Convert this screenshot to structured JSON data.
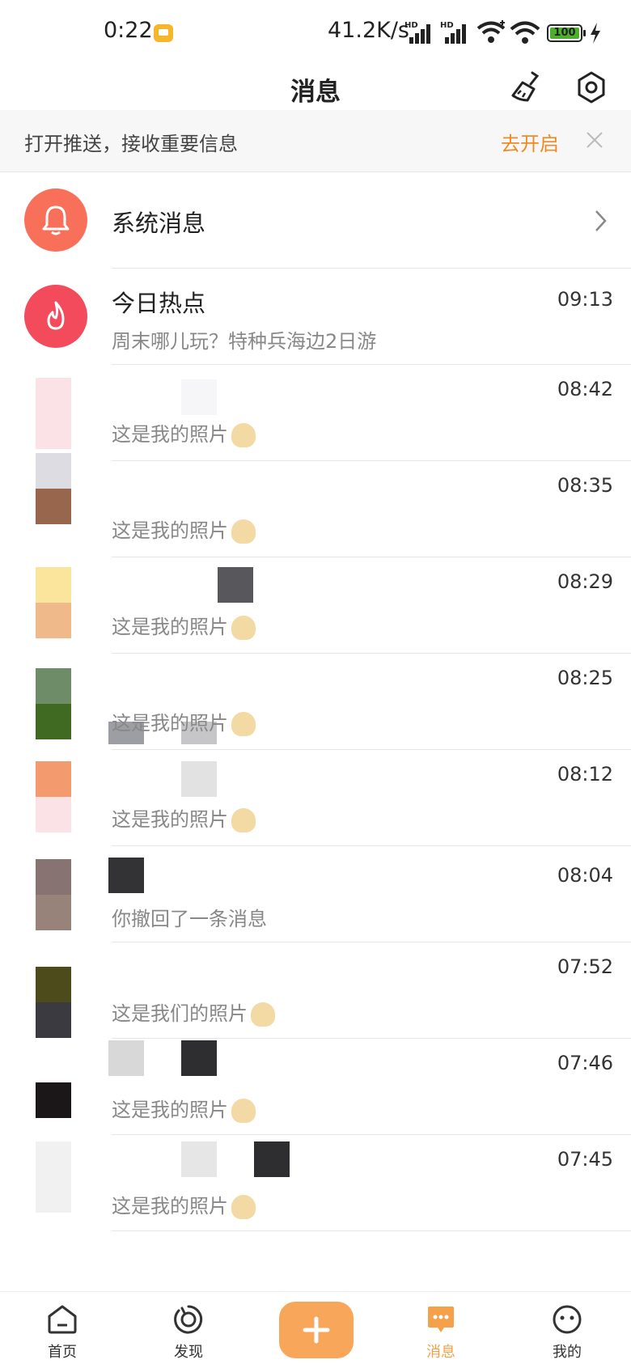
{
  "status_bar": {
    "time": "0:22",
    "net_speed": "41.2K/s",
    "battery": "100"
  },
  "header": {
    "title": "消息",
    "clean_icon": "broom-icon",
    "settings_icon": "hex-settings-icon"
  },
  "push_banner": {
    "text": "打开推送，接收重要信息",
    "action": "去开启"
  },
  "system_row": {
    "title": "系统消息",
    "icon": "bell-icon",
    "icon_bg": "#f8705a"
  },
  "hot_row": {
    "title": "今日热点",
    "subtitle": "周末哪儿玩？特种兵海边2日游",
    "time": "09:13",
    "icon": "flame-icon",
    "icon_bg": "#f34a5c"
  },
  "conversations": [
    {
      "preview": "这是我的照片",
      "time": "08:42"
    },
    {
      "preview": "这是我的照片",
      "time": "08:35"
    },
    {
      "preview": "这是我的照片",
      "time": "08:29"
    },
    {
      "preview": "这是我的照片",
      "time": "08:25"
    },
    {
      "preview": "这是我的照片",
      "time": "08:12"
    },
    {
      "preview": "你撤回了一条消息",
      "time": "08:04"
    },
    {
      "preview": "这是我们的照片",
      "time": "07:52"
    },
    {
      "preview": "这是我的照片",
      "time": "07:46"
    },
    {
      "preview": "这是我的照片",
      "time": "07:45"
    }
  ],
  "bottom_nav": {
    "home": "首页",
    "discover": "发现",
    "messages": "消息",
    "mine": "我的",
    "accent": "#f5a04a"
  }
}
